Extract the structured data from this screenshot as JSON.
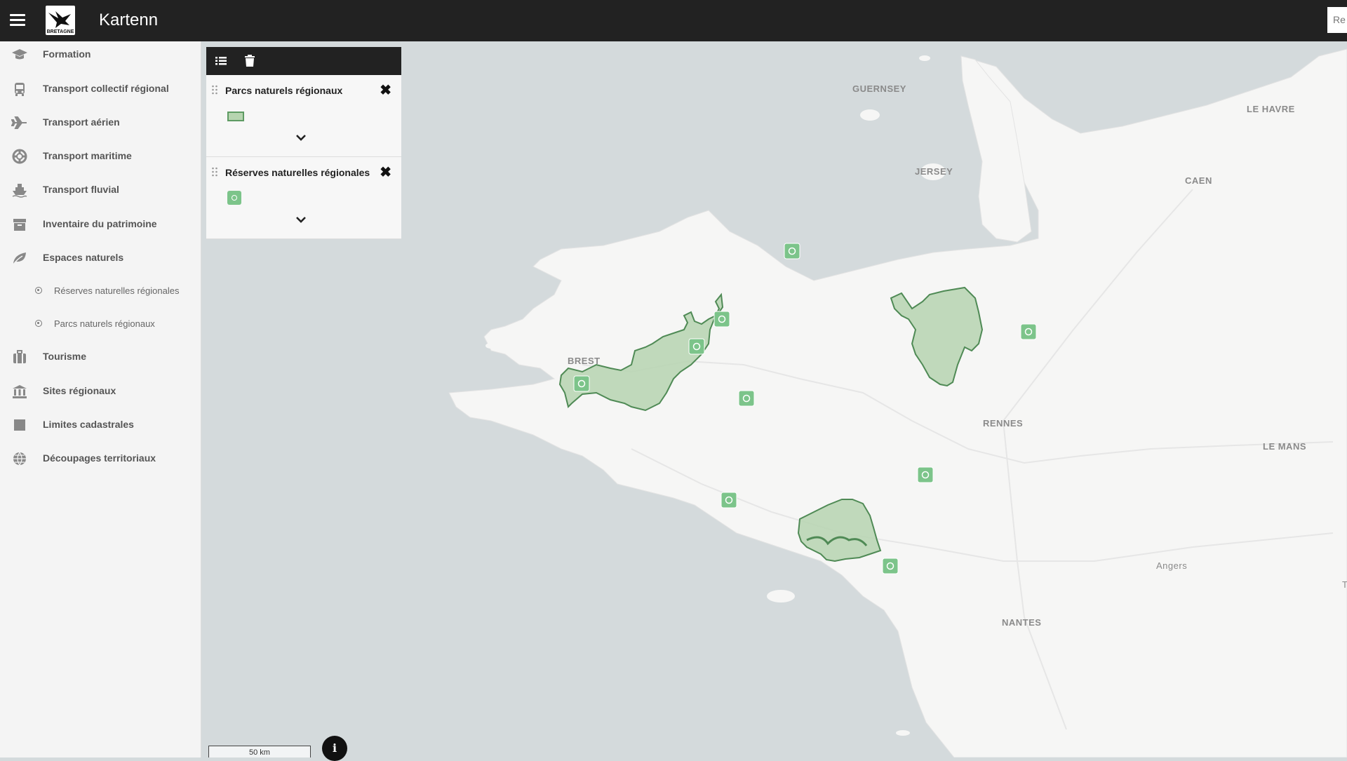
{
  "header": {
    "title": "Kartenn",
    "logo_text": "BRETAGNE",
    "search_placeholder": "Re"
  },
  "sidebar": {
    "items": [
      {
        "label": "Formation",
        "icon": "graduation-cap-icon"
      },
      {
        "label": "Transport collectif régional",
        "icon": "bus-icon"
      },
      {
        "label": "Transport aérien",
        "icon": "plane-icon"
      },
      {
        "label": "Transport maritime",
        "icon": "lifebuoy-icon"
      },
      {
        "label": "Transport fluvial",
        "icon": "ship-icon"
      },
      {
        "label": "Inventaire du patrimoine",
        "icon": "archive-icon"
      },
      {
        "label": "Espaces naturels",
        "icon": "leaf-icon"
      },
      {
        "label": "Tourisme",
        "icon": "suitcase-icon"
      },
      {
        "label": "Sites régionaux",
        "icon": "institution-icon"
      },
      {
        "label": "Limites cadastrales",
        "icon": "square-icon"
      },
      {
        "label": "Découpages territoriaux",
        "icon": "globe-icon"
      }
    ],
    "sub_items": [
      {
        "label": "Réserves naturelles régionales"
      },
      {
        "label": "Parcs naturels régionaux"
      }
    ]
  },
  "layers": [
    {
      "title": "Parcs naturels régionaux",
      "legend": "polygon",
      "fill": "#b6d4b0",
      "stroke": "#5e9b63"
    },
    {
      "title": "Réserves naturelles régionales",
      "legend": "point",
      "fill": "#7cc48a"
    }
  ],
  "layer_close_glyph": "✖",
  "map": {
    "labels": [
      "GUERNSEY",
      "JERSEY",
      "LE HAVRE",
      "CAEN",
      "BREST",
      "RENNES",
      "LE MANS",
      "Angers",
      "NANTES",
      "T"
    ],
    "scale": "50 km",
    "info": "i",
    "colors": {
      "land": "#f6f6f5",
      "sea": "#d4dadc",
      "park_fill": "#b6d4b0",
      "park_stroke": "#4f8a55",
      "reserve_marker": "#7cc48a"
    }
  }
}
